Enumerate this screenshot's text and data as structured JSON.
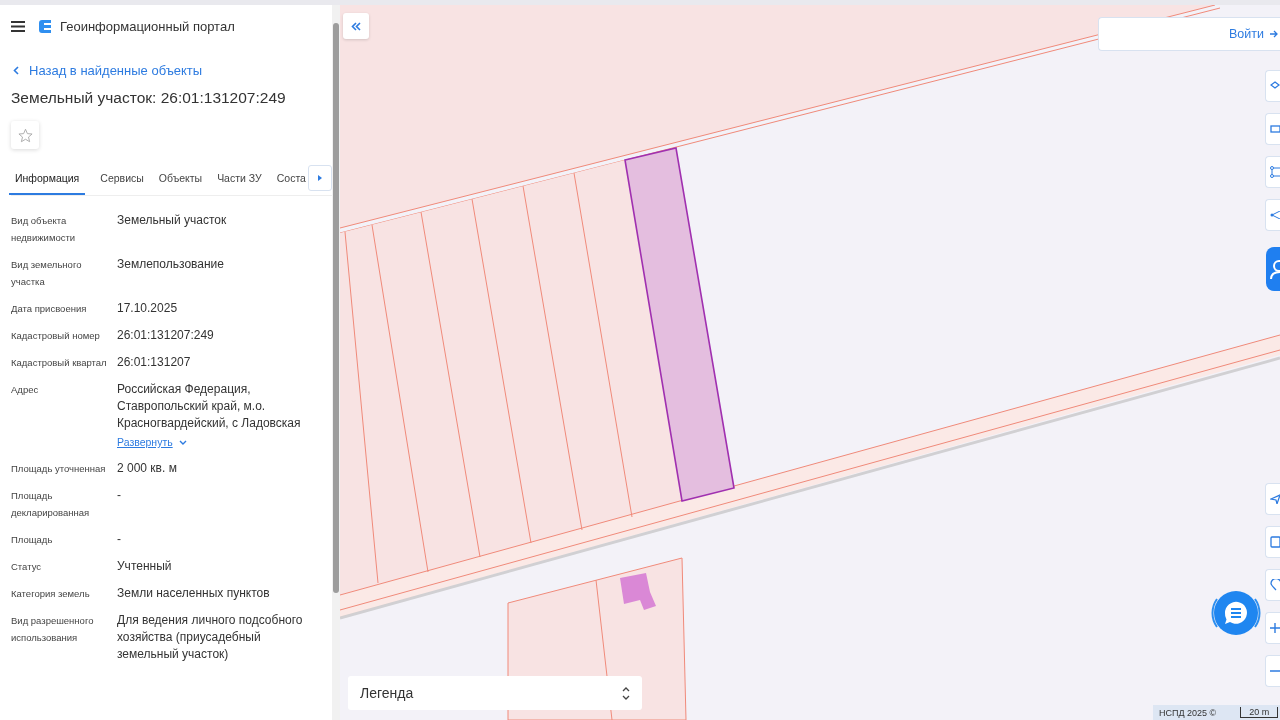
{
  "header": {
    "title": "Геоинформационный портал"
  },
  "back_link": "Назад в найденные объекты",
  "object_title": "Земельный участок: 26:01:131207:249",
  "favorite": {
    "on": false
  },
  "tabs": [
    {
      "label": "Информация",
      "selected": true
    },
    {
      "label": "Сервисы",
      "selected": false
    },
    {
      "label": "Объекты",
      "selected": false
    },
    {
      "label": "Части ЗУ",
      "selected": false
    },
    {
      "label": "Соста",
      "selected": false
    }
  ],
  "properties": [
    {
      "label": "Вид объекта недвижимости",
      "value": "Земельный участок"
    },
    {
      "label": "Вид земельного участка",
      "value": "Землепользование"
    },
    {
      "label": "Дата присвоения",
      "value": "17.10.2025"
    },
    {
      "label": "Кадастровый номер",
      "value": "26:01:131207:249"
    },
    {
      "label": "Кадастровый квартал",
      "value": "26:01:131207"
    },
    {
      "label": "Адрес",
      "value": "Российская Федерация, Ставропольский край, м.о. Красногвардейский, с Ладовская",
      "link": "Развернуть"
    },
    {
      "label": "Площадь уточненная",
      "value": "2 000 кв. м"
    },
    {
      "label": "Площадь декларированная",
      "value": "-"
    },
    {
      "label": "Площадь",
      "value": "-"
    },
    {
      "label": "Статус",
      "value": "Учтенный"
    },
    {
      "label": "Категория земель",
      "value": "Земли населенных пунктов"
    },
    {
      "label": "Вид разрешенного использования",
      "value": "Для ведения личного подсобного хозяйства (приусадебный земельный участок)"
    }
  ],
  "map": {
    "login": "Войти",
    "legend": "Легенда",
    "attribution": "НСПД 2025 ©",
    "scale": "20 m"
  }
}
